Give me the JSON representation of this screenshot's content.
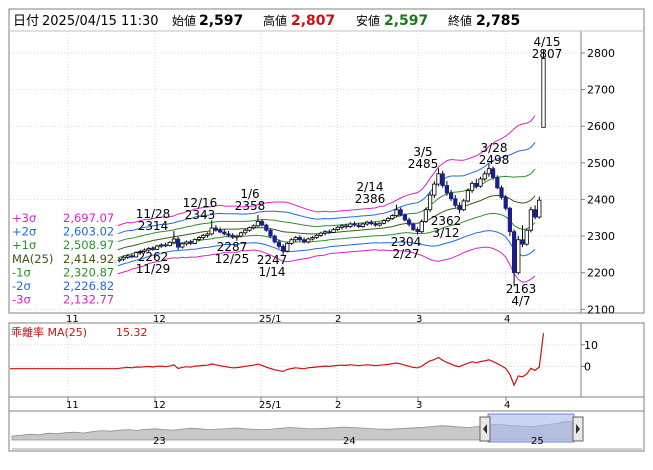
{
  "header": {
    "date_label": "日付",
    "date_value": "2025/04/15 11:30",
    "open_label": "始値",
    "open_value": "2,597",
    "high_label": "高値",
    "high_value": "2,807",
    "low_label": "安値",
    "low_value": "2,597",
    "close_label": "終値",
    "close_value": "2,785"
  },
  "colors": {
    "up": "#ffffff",
    "down": "#1a1f8f",
    "candle_edge": "#000000",
    "ma": "#3a5a10",
    "sigma1": "#2f8f2f",
    "sigma2": "#1e6be0",
    "sigma3": "#e020c8",
    "deviation": "#d01010",
    "high_value": "#d01010",
    "low_value": "#1a7a1a"
  },
  "chart_data": [
    {
      "type": "candlestick",
      "ylim": [
        2090,
        2860
      ],
      "y_ticks": [
        "2800",
        "2700",
        "2600",
        "2500",
        "2400",
        "2300",
        "2200",
        "2100"
      ],
      "x_tick_labels": [
        "11",
        "12",
        "25/1",
        "2",
        "3",
        "4"
      ],
      "legend": [
        {
          "key": "+3σ",
          "value": "2,697.07",
          "color": "#e020c8"
        },
        {
          "key": "+2σ",
          "value": "2,603.02",
          "color": "#1e6be0"
        },
        {
          "key": "+1σ",
          "value": "2,508.97",
          "color": "#2f8f2f"
        },
        {
          "key": "MA(25)",
          "value": "2,414.92",
          "color": "#3a5a10"
        },
        {
          "key": "-1σ",
          "value": "2,320.87",
          "color": "#2f8f2f"
        },
        {
          "key": "-2σ",
          "value": "2,226.82",
          "color": "#1e6be0"
        },
        {
          "key": "-3σ",
          "value": "2,132.77",
          "color": "#e020c8"
        }
      ],
      "annotations": [
        {
          "date": "11/28",
          "value": "2314",
          "kind": "high"
        },
        {
          "date": "11/29",
          "value": "2262",
          "kind": "low"
        },
        {
          "date": "12/16",
          "value": "2343",
          "kind": "high"
        },
        {
          "date": "12/25",
          "value": "2287",
          "kind": "low"
        },
        {
          "date": "1/6",
          "value": "2358",
          "kind": "high"
        },
        {
          "date": "1/14",
          "value": "2247",
          "kind": "low"
        },
        {
          "date": "2/14",
          "value": "2386",
          "kind": "high"
        },
        {
          "date": "2/27",
          "value": "2304",
          "kind": "low"
        },
        {
          "date": "3/5",
          "value": "2485",
          "kind": "high"
        },
        {
          "date": "3/12",
          "value": "2362",
          "kind": "low"
        },
        {
          "date": "3/28",
          "value": "2498",
          "kind": "high"
        },
        {
          "date": "4/7",
          "value": "2163",
          "kind": "low"
        },
        {
          "date": "4/15",
          "value": "2807",
          "kind": "high"
        }
      ],
      "candles": [
        {
          "o": 2228,
          "h": 2236,
          "l": 2222,
          "c": 2233
        },
        {
          "o": 2233,
          "h": 2240,
          "l": 2228,
          "c": 2237
        },
        {
          "o": 2237,
          "h": 2246,
          "l": 2232,
          "c": 2242
        },
        {
          "o": 2242,
          "h": 2250,
          "l": 2238,
          "c": 2246
        },
        {
          "o": 2246,
          "h": 2252,
          "l": 2240,
          "c": 2243
        },
        {
          "o": 2243,
          "h": 2258,
          "l": 2242,
          "c": 2255
        },
        {
          "o": 2255,
          "h": 2262,
          "l": 2249,
          "c": 2258
        },
        {
          "o": 2258,
          "h": 2266,
          "l": 2253,
          "c": 2262
        },
        {
          "o": 2262,
          "h": 2270,
          "l": 2257,
          "c": 2266
        },
        {
          "o": 2266,
          "h": 2272,
          "l": 2260,
          "c": 2264
        },
        {
          "o": 2264,
          "h": 2276,
          "l": 2262,
          "c": 2273
        },
        {
          "o": 2273,
          "h": 2280,
          "l": 2268,
          "c": 2276
        },
        {
          "o": 2276,
          "h": 2282,
          "l": 2270,
          "c": 2274
        },
        {
          "o": 2274,
          "h": 2286,
          "l": 2272,
          "c": 2283
        },
        {
          "o": 2283,
          "h": 2314,
          "l": 2280,
          "c": 2292
        },
        {
          "o": 2292,
          "h": 2298,
          "l": 2262,
          "c": 2270
        },
        {
          "o": 2270,
          "h": 2282,
          "l": 2266,
          "c": 2279
        },
        {
          "o": 2279,
          "h": 2288,
          "l": 2274,
          "c": 2284
        },
        {
          "o": 2284,
          "h": 2290,
          "l": 2276,
          "c": 2280
        },
        {
          "o": 2280,
          "h": 2294,
          "l": 2278,
          "c": 2291
        },
        {
          "o": 2291,
          "h": 2300,
          "l": 2286,
          "c": 2296
        },
        {
          "o": 2296,
          "h": 2306,
          "l": 2290,
          "c": 2302
        },
        {
          "o": 2302,
          "h": 2310,
          "l": 2296,
          "c": 2306
        },
        {
          "o": 2306,
          "h": 2343,
          "l": 2302,
          "c": 2322
        },
        {
          "o": 2322,
          "h": 2330,
          "l": 2312,
          "c": 2316
        },
        {
          "o": 2316,
          "h": 2324,
          "l": 2308,
          "c": 2311
        },
        {
          "o": 2311,
          "h": 2318,
          "l": 2302,
          "c": 2306
        },
        {
          "o": 2306,
          "h": 2314,
          "l": 2298,
          "c": 2302
        },
        {
          "o": 2302,
          "h": 2308,
          "l": 2292,
          "c": 2297
        },
        {
          "o": 2297,
          "h": 2304,
          "l": 2287,
          "c": 2300
        },
        {
          "o": 2300,
          "h": 2312,
          "l": 2296,
          "c": 2309
        },
        {
          "o": 2309,
          "h": 2320,
          "l": 2304,
          "c": 2316
        },
        {
          "o": 2316,
          "h": 2326,
          "l": 2312,
          "c": 2323
        },
        {
          "o": 2323,
          "h": 2332,
          "l": 2318,
          "c": 2328
        },
        {
          "o": 2328,
          "h": 2358,
          "l": 2324,
          "c": 2340
        },
        {
          "o": 2340,
          "h": 2346,
          "l": 2326,
          "c": 2330
        },
        {
          "o": 2330,
          "h": 2334,
          "l": 2312,
          "c": 2316
        },
        {
          "o": 2316,
          "h": 2320,
          "l": 2296,
          "c": 2300
        },
        {
          "o": 2300,
          "h": 2304,
          "l": 2280,
          "c": 2284
        },
        {
          "o": 2284,
          "h": 2290,
          "l": 2266,
          "c": 2272
        },
        {
          "o": 2272,
          "h": 2278,
          "l": 2247,
          "c": 2259
        },
        {
          "o": 2259,
          "h": 2284,
          "l": 2256,
          "c": 2280
        },
        {
          "o": 2280,
          "h": 2294,
          "l": 2276,
          "c": 2290
        },
        {
          "o": 2290,
          "h": 2300,
          "l": 2284,
          "c": 2296
        },
        {
          "o": 2296,
          "h": 2302,
          "l": 2286,
          "c": 2290
        },
        {
          "o": 2290,
          "h": 2296,
          "l": 2280,
          "c": 2284
        },
        {
          "o": 2284,
          "h": 2296,
          "l": 2280,
          "c": 2292
        },
        {
          "o": 2292,
          "h": 2300,
          "l": 2288,
          "c": 2296
        },
        {
          "o": 2296,
          "h": 2306,
          "l": 2292,
          "c": 2302
        },
        {
          "o": 2302,
          "h": 2312,
          "l": 2298,
          "c": 2308
        },
        {
          "o": 2308,
          "h": 2316,
          "l": 2302,
          "c": 2312
        },
        {
          "o": 2312,
          "h": 2318,
          "l": 2306,
          "c": 2310
        },
        {
          "o": 2310,
          "h": 2322,
          "l": 2308,
          "c": 2318
        },
        {
          "o": 2318,
          "h": 2328,
          "l": 2314,
          "c": 2324
        },
        {
          "o": 2324,
          "h": 2332,
          "l": 2318,
          "c": 2328
        },
        {
          "o": 2328,
          "h": 2334,
          "l": 2320,
          "c": 2326
        },
        {
          "o": 2326,
          "h": 2338,
          "l": 2322,
          "c": 2333
        },
        {
          "o": 2333,
          "h": 2340,
          "l": 2326,
          "c": 2330
        },
        {
          "o": 2330,
          "h": 2336,
          "l": 2322,
          "c": 2326
        },
        {
          "o": 2326,
          "h": 2336,
          "l": 2322,
          "c": 2333
        },
        {
          "o": 2333,
          "h": 2342,
          "l": 2328,
          "c": 2338
        },
        {
          "o": 2338,
          "h": 2344,
          "l": 2330,
          "c": 2334
        },
        {
          "o": 2334,
          "h": 2340,
          "l": 2326,
          "c": 2330
        },
        {
          "o": 2330,
          "h": 2338,
          "l": 2326,
          "c": 2335
        },
        {
          "o": 2335,
          "h": 2346,
          "l": 2332,
          "c": 2342
        },
        {
          "o": 2342,
          "h": 2352,
          "l": 2338,
          "c": 2348
        },
        {
          "o": 2348,
          "h": 2360,
          "l": 2344,
          "c": 2356
        },
        {
          "o": 2356,
          "h": 2386,
          "l": 2352,
          "c": 2372
        },
        {
          "o": 2372,
          "h": 2378,
          "l": 2354,
          "c": 2358
        },
        {
          "o": 2358,
          "h": 2362,
          "l": 2340,
          "c": 2344
        },
        {
          "o": 2344,
          "h": 2350,
          "l": 2326,
          "c": 2332
        },
        {
          "o": 2332,
          "h": 2336,
          "l": 2314,
          "c": 2318
        },
        {
          "o": 2318,
          "h": 2324,
          "l": 2304,
          "c": 2312
        },
        {
          "o": 2312,
          "h": 2346,
          "l": 2308,
          "c": 2340
        },
        {
          "o": 2340,
          "h": 2378,
          "l": 2336,
          "c": 2372
        },
        {
          "o": 2372,
          "h": 2420,
          "l": 2366,
          "c": 2412
        },
        {
          "o": 2412,
          "h": 2450,
          "l": 2404,
          "c": 2442
        },
        {
          "o": 2442,
          "h": 2485,
          "l": 2436,
          "c": 2470
        },
        {
          "o": 2470,
          "h": 2478,
          "l": 2432,
          "c": 2438
        },
        {
          "o": 2438,
          "h": 2450,
          "l": 2410,
          "c": 2418
        },
        {
          "o": 2418,
          "h": 2426,
          "l": 2396,
          "c": 2402
        },
        {
          "o": 2402,
          "h": 2412,
          "l": 2378,
          "c": 2384
        },
        {
          "o": 2384,
          "h": 2392,
          "l": 2362,
          "c": 2372
        },
        {
          "o": 2372,
          "h": 2402,
          "l": 2368,
          "c": 2396
        },
        {
          "o": 2396,
          "h": 2430,
          "l": 2392,
          "c": 2424
        },
        {
          "o": 2424,
          "h": 2450,
          "l": 2418,
          "c": 2444
        },
        {
          "o": 2444,
          "h": 2456,
          "l": 2430,
          "c": 2436
        },
        {
          "o": 2436,
          "h": 2462,
          "l": 2432,
          "c": 2456
        },
        {
          "o": 2456,
          "h": 2478,
          "l": 2450,
          "c": 2470
        },
        {
          "o": 2470,
          "h": 2498,
          "l": 2462,
          "c": 2484
        },
        {
          "o": 2484,
          "h": 2490,
          "l": 2454,
          "c": 2460
        },
        {
          "o": 2460,
          "h": 2466,
          "l": 2428,
          "c": 2432
        },
        {
          "o": 2432,
          "h": 2438,
          "l": 2400,
          "c": 2406
        },
        {
          "o": 2406,
          "h": 2412,
          "l": 2370,
          "c": 2376
        },
        {
          "o": 2376,
          "h": 2380,
          "l": 2300,
          "c": 2312
        },
        {
          "o": 2312,
          "h": 2318,
          "l": 2163,
          "c": 2200
        },
        {
          "o": 2200,
          "h": 2300,
          "l": 2195,
          "c": 2290
        },
        {
          "o": 2290,
          "h": 2330,
          "l": 2270,
          "c": 2278
        },
        {
          "o": 2278,
          "h": 2320,
          "l": 2274,
          "c": 2316
        },
        {
          "o": 2316,
          "h": 2380,
          "l": 2310,
          "c": 2372
        },
        {
          "o": 2372,
          "h": 2384,
          "l": 2346,
          "c": 2352
        },
        {
          "o": 2352,
          "h": 2408,
          "l": 2348,
          "c": 2398
        },
        {
          "o": 2597,
          "h": 2807,
          "l": 2597,
          "c": 2785
        }
      ],
      "bands": {
        "ma": [
          2262,
          2264,
          2268,
          2271,
          2273,
          2276,
          2279,
          2282,
          2285,
          2288,
          2290,
          2292,
          2294,
          2296,
          2298,
          2300,
          2302,
          2304,
          2306,
          2308,
          2310,
          2312,
          2313,
          2315,
          2317,
          2318,
          2319,
          2319,
          2319,
          2319,
          2320,
          2320,
          2321,
          2322,
          2323,
          2323,
          2322,
          2320,
          2318,
          2315,
          2312,
          2311,
          2310,
          2309,
          2308,
          2307,
          2306,
          2306,
          2306,
          2307,
          2308,
          2309,
          2310,
          2311,
          2312,
          2313,
          2314,
          2315,
          2316,
          2317,
          2318,
          2319,
          2320,
          2321,
          2322,
          2324,
          2326,
          2329,
          2332,
          2334,
          2335,
          2335,
          2335,
          2337,
          2341,
          2347,
          2353,
          2360,
          2366,
          2371,
          2374,
          2376,
          2378,
          2381,
          2385,
          2389,
          2393,
          2397,
          2402,
          2407,
          2410,
          2411,
          2410,
          2408,
          2402,
          2395,
          2392,
          2390,
          2392,
          2398,
          2410
        ],
        "s1": [
          22,
          22,
          22,
          22,
          21,
          21,
          21,
          21,
          20,
          20,
          20,
          20,
          19,
          19,
          19,
          20,
          20,
          21,
          21,
          22,
          22,
          22,
          22,
          22,
          22,
          22,
          21,
          21,
          21,
          21,
          20,
          20,
          20,
          20,
          21,
          22,
          23,
          24,
          25,
          26,
          27,
          27,
          26,
          25,
          24,
          23,
          22,
          21,
          20,
          20,
          20,
          19,
          19,
          19,
          19,
          19,
          19,
          19,
          19,
          19,
          19,
          19,
          19,
          20,
          20,
          21,
          22,
          23,
          24,
          25,
          26,
          27,
          28,
          30,
          33,
          37,
          40,
          43,
          44,
          45,
          45,
          44,
          43,
          42,
          42,
          42,
          42,
          43,
          44,
          46,
          48,
          50,
          52,
          55,
          60,
          66,
          70,
          72,
          72,
          72,
          73
        ]
      }
    },
    {
      "type": "line",
      "title": "乖離率 MA(25)",
      "value_label": "15.32",
      "y_ticks": [
        "10",
        "0"
      ],
      "ylim": [
        -14,
        20
      ],
      "x_tick_labels": [
        "11",
        "12",
        "25/1",
        "2",
        "3",
        "4"
      ],
      "values": [
        -1.0,
        -0.8,
        -0.6,
        -0.4,
        -0.6,
        -0.2,
        -0.3,
        -0.1,
        0.0,
        -0.2,
        0.1,
        0.2,
        -0.1,
        0.2,
        0.8,
        -0.9,
        -0.4,
        -0.1,
        -0.3,
        0.2,
        0.3,
        0.5,
        0.6,
        1.2,
        0.8,
        0.4,
        0.0,
        -0.3,
        -0.6,
        -0.5,
        -0.2,
        0.1,
        0.4,
        0.6,
        1.1,
        0.5,
        -0.3,
        -0.9,
        -1.5,
        -1.9,
        -2.3,
        -1.3,
        -0.9,
        -0.6,
        -0.8,
        -1.0,
        -0.6,
        -0.4,
        -0.2,
        0.0,
        0.2,
        0.1,
        0.3,
        0.5,
        0.6,
        0.5,
        0.8,
        0.6,
        0.4,
        0.6,
        0.8,
        0.6,
        0.4,
        0.6,
        0.8,
        1.0,
        1.3,
        1.6,
        1.2,
        0.6,
        0.1,
        -0.4,
        -0.6,
        0.1,
        1.5,
        2.6,
        3.2,
        4.2,
        2.8,
        1.9,
        1.1,
        0.3,
        -0.1,
        0.8,
        1.5,
        2.2,
        1.7,
        2.3,
        2.6,
        3.1,
        2.3,
        1.3,
        0.3,
        -0.8,
        -3.6,
        -8.6,
        -4.3,
        -4.7,
        -3.5,
        -0.8,
        -1.8,
        -0.2,
        15.32
      ]
    },
    {
      "type": "area",
      "x_tick_labels": [
        "23",
        "24",
        "25"
      ],
      "values": [
        2050,
        2080,
        2120,
        2100,
        2160,
        2140,
        2180,
        2200,
        2170,
        2220,
        2260,
        2240,
        2280,
        2300,
        2270,
        2310,
        2330,
        2300,
        2280,
        2320,
        2350,
        2330,
        2300,
        2320,
        2340,
        2360,
        2330,
        2310,
        2300,
        2320,
        2350,
        2380,
        2360,
        2340,
        2330,
        2350,
        2370,
        2400,
        2380,
        2360,
        2340,
        2320,
        2310,
        2330,
        2350,
        2370,
        2390,
        2420,
        2450,
        2430,
        2400,
        2380,
        2420,
        2470,
        2500,
        2480,
        2450,
        2430,
        2420,
        2450,
        2500,
        2550,
        2620,
        2590
      ]
    },
    {
      "type": "axis",
      "x_tick_labels": [
        "11",
        "12",
        "25/1",
        "2",
        "3",
        "4"
      ]
    }
  ]
}
